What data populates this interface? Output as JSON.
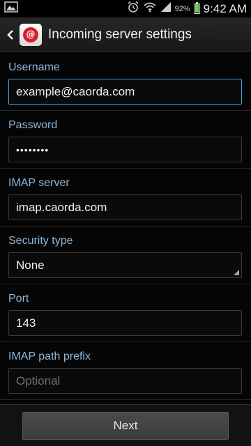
{
  "status_bar": {
    "battery_percent": "92%",
    "time": "9:42 AM",
    "icons": [
      "gallery-icon",
      "alarm-icon",
      "wifi-icon",
      "signal-icon",
      "battery-icon"
    ]
  },
  "action_bar": {
    "title": "Incoming server settings",
    "app_icon_glyph": "@"
  },
  "form": {
    "username": {
      "label": "Username",
      "value": "example@caorda.com"
    },
    "password": {
      "label": "Password",
      "value": "••••••••"
    },
    "imap_server": {
      "label": "IMAP server",
      "value": "imap.caorda.com"
    },
    "security_type": {
      "label": "Security type",
      "value": "None"
    },
    "port": {
      "label": "Port",
      "value": "143"
    },
    "imap_path_prefix": {
      "label": "IMAP path prefix",
      "placeholder": "Optional"
    }
  },
  "bottom": {
    "next_label": "Next"
  },
  "colors": {
    "label": "#8fb8da",
    "focus_border": "#43a8d8",
    "app_icon_red": "#d61f2e",
    "battery_green": "#6fd14c"
  }
}
